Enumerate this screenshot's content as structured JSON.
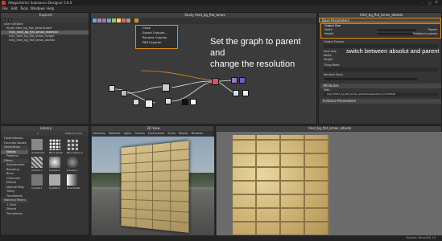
{
  "window": {
    "title": "Allegorithmic Substance Designer 5.6.0"
  },
  "menubar": [
    "File",
    "Edit",
    "Tools",
    "Windows",
    "Help"
  ],
  "explorer": {
    "title": "Explorer",
    "items": [
      {
        "label": "User Untitled"
      },
      {
        "label": "Study tiled_bg_flat_default.sbs*"
      },
      {
        "label": "Fully_tiled_bg_flat_bmax_material"
      },
      {
        "label": "fully_tiled_bg_flat_bmax_height"
      },
      {
        "label": "fully_tiled_bg_flat_bmax_albedo"
      }
    ]
  },
  "graph": {
    "title": "Study tiled_bg_flat_bmax",
    "context_menu": [
      "Close",
      "Export Outputs...",
      "Rename Outputs",
      "PBR Exporter"
    ],
    "caption": [
      "Set the graph to parent and",
      "change the resolution"
    ]
  },
  "properties": {
    "tab": "tiled_bg_flat_bmax_albedo",
    "sections": {
      "base": "Base Parameters",
      "output_size": "Output Size",
      "output_format": "Output Format",
      "pixel_size": "Pixel Size",
      "tiling": "Tiling Mode",
      "random_seed": "Random Seed",
      "attributes": "Attributes",
      "instance": "Instance Parameters"
    },
    "rows": {
      "width": "Width",
      "height": "Height",
      "width_val": "Parent",
      "height_val": "Relative to parent",
      "path_label": "Path",
      "path": "pkg:///tiled_bg_flat_bmax_albedo?dependency=1234567"
    },
    "note": "switch between absolut and parent"
  },
  "library": {
    "title": "Library",
    "search_placeholder": "Medium Icons",
    "categories": [
      "Folder/Nodes",
      "Function Nodes",
      "Generators",
      "Noises",
      "Patterns",
      "Filters",
      "Adjustments",
      "Blending",
      "Blurs",
      "Channels",
      "Effects",
      "Normal Map",
      "Tiling",
      "Transforms",
      "Material Filters",
      "1-Click",
      "Effects",
      "Transforms"
    ],
    "thumbs": [
      "Anisotropic",
      "Brick Spots",
      "Brick Spots 2",
      "Clouds 1",
      "Clouds 2",
      "Clouds 3",
      "Crystal 1",
      "Crystal 2",
      "Directional"
    ]
  },
  "view3d": {
    "title": "3D View",
    "menu": [
      "Geometry",
      "Materials",
      "Lights",
      "Camera",
      "Environment",
      "Scene",
      "Display",
      "Renderer"
    ]
  },
  "view2d": {
    "title": "tiled_bg_flat_bmax_albedo"
  },
  "status": {
    "text": "Engine: Direct3D 10"
  },
  "colors": {
    "accent": "#e08a1e",
    "bg": "#2b2b2b",
    "panel": "#353535"
  }
}
